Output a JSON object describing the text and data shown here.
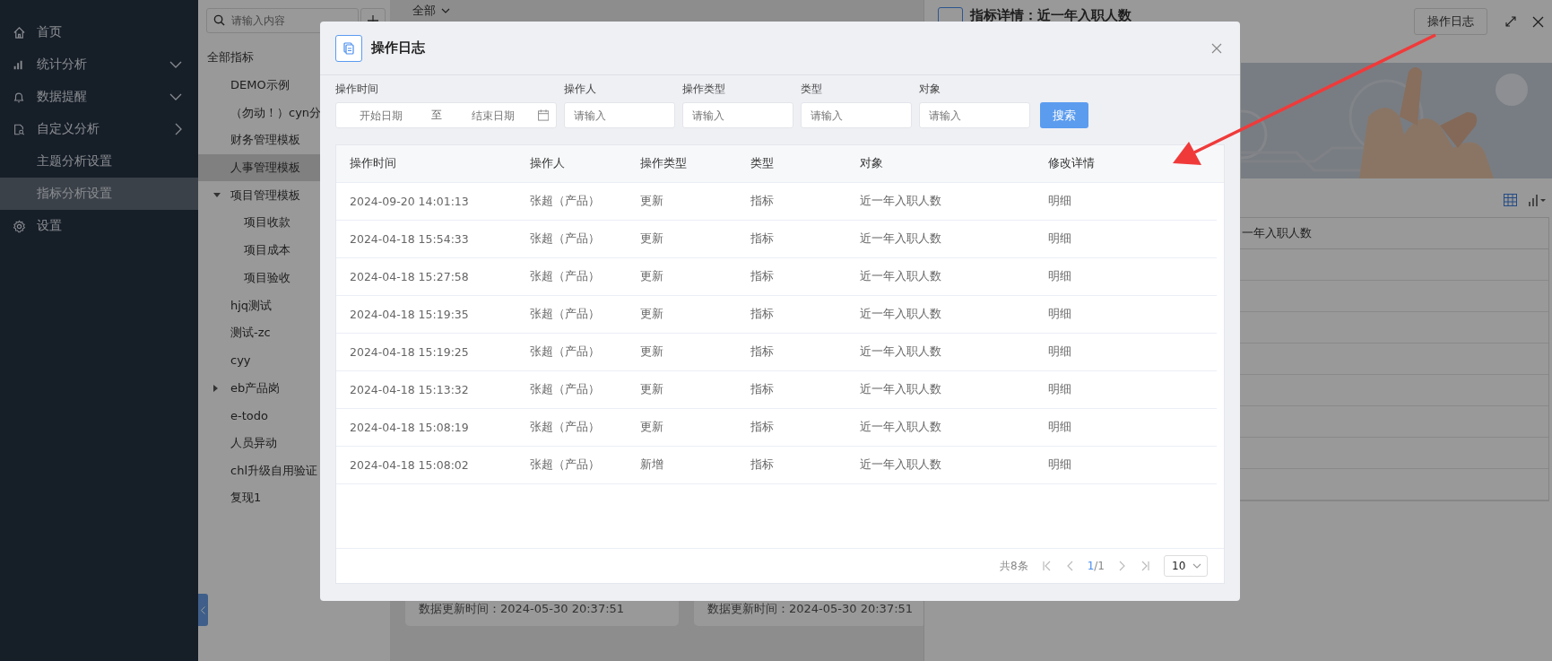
{
  "sidebar": {
    "items": [
      {
        "label": "首页",
        "kind": "link",
        "selected": false
      },
      {
        "label": "统计分析",
        "kind": "submenu",
        "selected": false
      },
      {
        "label": "数据提醒",
        "kind": "submenu",
        "selected": false
      },
      {
        "label": "自定义分析",
        "kind": "popout",
        "selected": false
      },
      {
        "label": "主题分析设置",
        "kind": "link",
        "selected": false
      },
      {
        "label": "指标分析设置",
        "kind": "link",
        "selected": true
      },
      {
        "label": "设置",
        "kind": "link",
        "selected": false
      }
    ]
  },
  "tree_panel": {
    "search": {
      "placeholder": "请输入内容"
    },
    "tree": [
      {
        "label": "全部指标",
        "selected": false,
        "children": [
          {
            "label": "DEMO示例",
            "selected": false
          },
          {
            "label": "（勿动！）cyn分",
            "selected": false
          },
          {
            "label": "财务管理模板",
            "selected": false
          },
          {
            "label": "人事管理模板",
            "selected": true
          },
          {
            "label": "项目管理模板",
            "selected": false,
            "expanded": true,
            "children": [
              {
                "label": "项目收款",
                "selected": false
              },
              {
                "label": "项目成本",
                "selected": false
              },
              {
                "label": "项目验收",
                "selected": false
              }
            ]
          },
          {
            "label": "hjq测试",
            "selected": false
          },
          {
            "label": "测试-zc",
            "selected": false
          },
          {
            "label": "cyy",
            "selected": false
          },
          {
            "label": "eb产品岗",
            "selected": false,
            "expanded": false
          },
          {
            "label": "e-todo",
            "selected": false
          },
          {
            "label": "人员异动",
            "selected": false
          },
          {
            "label": "chl升级自用验证",
            "selected": false
          },
          {
            "label": "复现1",
            "selected": false
          }
        ]
      }
    ]
  },
  "middle": {
    "filter": "全部",
    "cards": [
      {
        "update_time": "数据更新时间：2024-05-30 20:37:51"
      },
      {
        "update_time": "数据更新时间：2024-05-30 20:37:51"
      }
    ]
  },
  "detail": {
    "title": "指标详情：近一年入职人数",
    "log_button": "操作日志",
    "table_header": "一年入职人数"
  },
  "modal": {
    "title": "操作日志",
    "filters": [
      {
        "label": "操作时间",
        "kind": "daterange",
        "start_placeholder": "开始日期",
        "separator": "至",
        "end_placeholder": "结束日期"
      },
      {
        "label": "操作人",
        "kind": "text",
        "placeholder": "请输入"
      },
      {
        "label": "操作类型",
        "kind": "text",
        "placeholder": "请输入"
      },
      {
        "label": "类型",
        "kind": "text",
        "placeholder": "请输入"
      },
      {
        "label": "对象",
        "kind": "text",
        "placeholder": "请输入"
      }
    ],
    "search_button": "搜索",
    "table": {
      "columns": [
        "操作时间",
        "操作人",
        "操作类型",
        "类型",
        "对象",
        "修改详情"
      ],
      "rows": [
        [
          "2024-09-20 14:01:13",
          "张超（产品）",
          "更新",
          "指标",
          "近一年入职人数",
          "明细"
        ],
        [
          "2024-04-18 15:54:33",
          "张超（产品）",
          "更新",
          "指标",
          "近一年入职人数",
          "明细"
        ],
        [
          "2024-04-18 15:27:58",
          "张超（产品）",
          "更新",
          "指标",
          "近一年入职人数",
          "明细"
        ],
        [
          "2024-04-18 15:19:35",
          "张超（产品）",
          "更新",
          "指标",
          "近一年入职人数",
          "明细"
        ],
        [
          "2024-04-18 15:19:25",
          "张超（产品）",
          "更新",
          "指标",
          "近一年入职人数",
          "明细"
        ],
        [
          "2024-04-18 15:13:32",
          "张超（产品）",
          "更新",
          "指标",
          "近一年入职人数",
          "明细"
        ],
        [
          "2024-04-18 15:08:19",
          "张超（产品）",
          "更新",
          "指标",
          "近一年入职人数",
          "明细"
        ],
        [
          "2024-04-18 15:08:02",
          "张超（产品）",
          "新增",
          "指标",
          "近一年入职人数",
          "明细"
        ]
      ]
    },
    "pagination": {
      "total": "共8条",
      "current": "1",
      "of_pages": "/1",
      "page_size": "10"
    }
  }
}
